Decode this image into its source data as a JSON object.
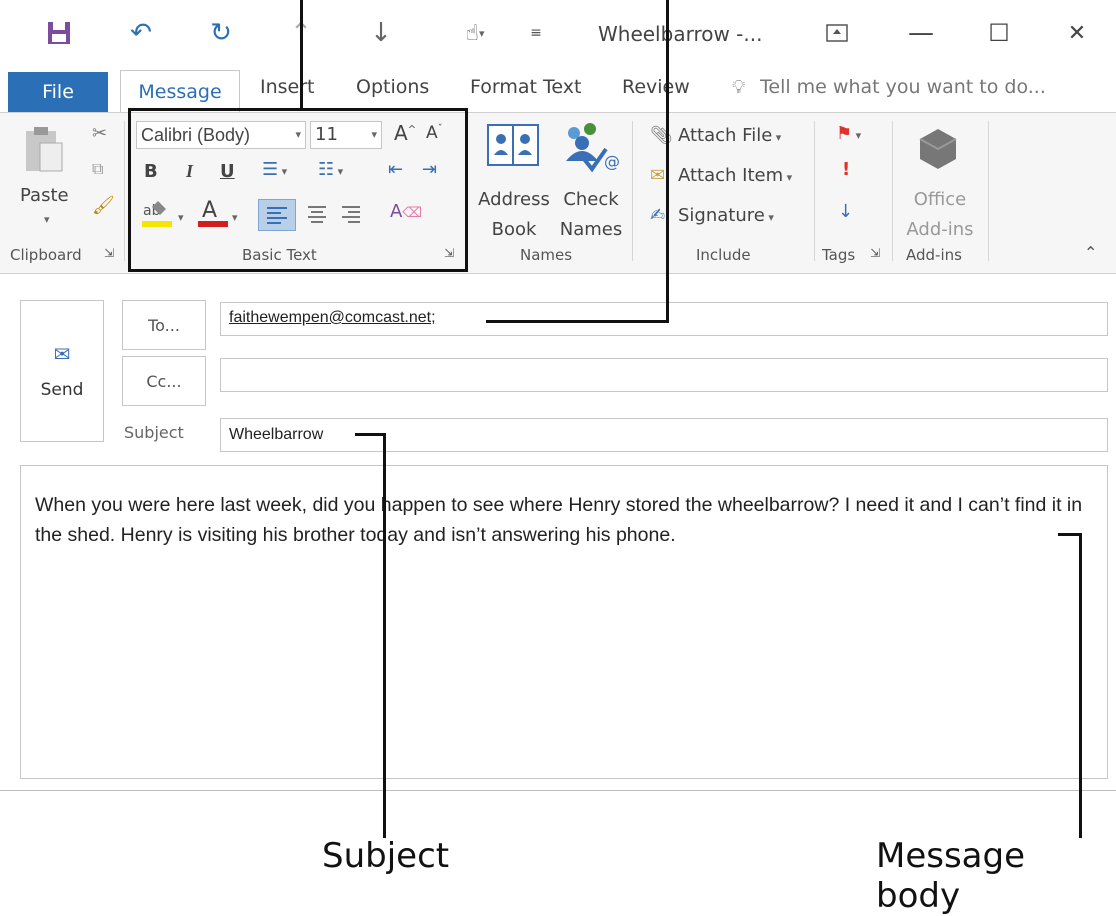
{
  "window": {
    "title": "Wheelbarrow -...",
    "controls": {
      "restore_icon": "ribbon-display-icon",
      "minimize": "—",
      "maximize": "☐",
      "close": "✕"
    }
  },
  "quick_access": {
    "save": "save-icon",
    "undo": "undo-icon",
    "redo": "redo-icon",
    "up": "previous-item-icon",
    "down": "next-item-icon",
    "touch": "touch-mode-icon"
  },
  "tabs": {
    "file": "File",
    "message": "Message",
    "insert": "Insert",
    "options": "Options",
    "format_text": "Format Text",
    "review": "Review",
    "tell_me": "Tell me what you want to do..."
  },
  "ribbon": {
    "clipboard": {
      "paste": "Paste",
      "label": "Clipboard"
    },
    "basic_text": {
      "font": "Calibri (Body)",
      "size": "11",
      "bold": "B",
      "italic": "I",
      "underline": "U",
      "label": "Basic Text"
    },
    "names": {
      "address_book_1": "Address",
      "address_book_2": "Book",
      "check_names_1": "Check",
      "check_names_2": "Names",
      "label": "Names"
    },
    "include": {
      "attach_file": "Attach File",
      "attach_item": "Attach Item",
      "signature": "Signature",
      "label": "Include"
    },
    "tags": {
      "label": "Tags"
    },
    "addins": {
      "office_1": "Office",
      "office_2": "Add-ins",
      "label": "Add-ins"
    }
  },
  "form": {
    "send": "Send",
    "to_button": "To...",
    "cc_button": "Cc...",
    "subject_label": "Subject",
    "to_value": "faithewempen@comcast.net;",
    "cc_value": "",
    "subject_value": "Wheelbarrow",
    "body": "When you were here last week, did you happen to see where Henry stored the wheelbarrow? I need it and I can’t find it in the shed. Henry is visiting his brother today and isn’t answering his phone."
  },
  "callouts": {
    "subject": "Subject",
    "message_body": "Message body"
  },
  "colors": {
    "accent": "#2b6fb7",
    "flag": "#e0312e",
    "callout_line": "#111111"
  }
}
